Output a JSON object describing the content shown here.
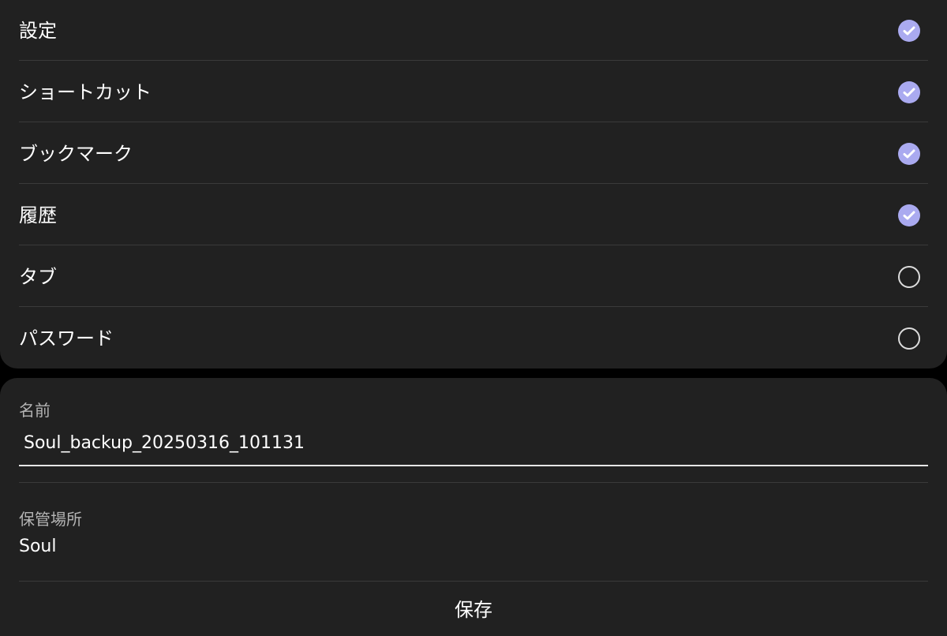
{
  "options": {
    "items": [
      {
        "label": "設定",
        "checked": true
      },
      {
        "label": "ショートカット",
        "checked": true
      },
      {
        "label": "ブックマーク",
        "checked": true
      },
      {
        "label": "履歴",
        "checked": true
      },
      {
        "label": "タブ",
        "checked": false
      },
      {
        "label": "パスワード",
        "checked": false
      }
    ]
  },
  "form": {
    "name_label": "名前",
    "name_value": "Soul_backup_20250316_101131",
    "location_label": "保管場所",
    "location_value": "Soul",
    "save_label": "保存"
  },
  "colors": {
    "card_background": "#212121",
    "check_accent": "#aaaaf0"
  }
}
